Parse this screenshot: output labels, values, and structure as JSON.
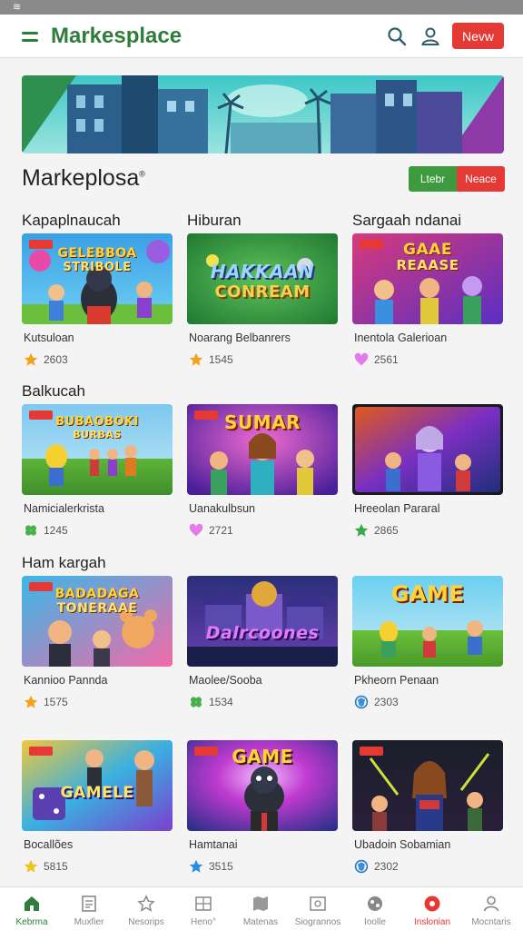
{
  "status_bar": {
    "glyph": "≋"
  },
  "header": {
    "title": "Markesplace",
    "new_button": "Nevw",
    "icons": [
      "menu-icon",
      "search-icon",
      "user-icon"
    ],
    "accent": "#2f7d3a",
    "button_color": "#e53935"
  },
  "section": {
    "title": "Markeplosa",
    "title_mark": "®",
    "toggle_left": "Ltebr",
    "toggle_right": "Neace"
  },
  "categories": {
    "c1": "Kapaplnaucah",
    "c2": "Hiburan",
    "c3": "Sargaah ndanai",
    "c4": "Balkucah",
    "c5": "Ham kargah"
  },
  "cards": [
    {
      "name": "Kutsuloan",
      "rating": "2603",
      "rating_icon": "star-icon",
      "thumb_title_1": "GELEBBOA",
      "thumb_title_2": "STRIBOLE"
    },
    {
      "name": "Noarang Belbanrers",
      "rating": "1545",
      "rating_icon": "star-icon",
      "thumb_title_1": "HAKKAAN",
      "thumb_title_2": "CONREAM"
    },
    {
      "name": "Inentola Galerioan",
      "rating": "2561",
      "rating_icon": "heart-icon",
      "thumb_title_1": "GAAE",
      "thumb_title_2": "REAASE"
    },
    {
      "name": "Namicialerkrista",
      "rating": "1245",
      "rating_icon": "clover-icon",
      "thumb_title_1": "BUBAOBOKI",
      "thumb_title_2": "BURBAS"
    },
    {
      "name": "Uanakulbsun",
      "rating": "2721",
      "rating_icon": "heart-icon",
      "thumb_title_1": "SUMAR",
      "thumb_title_2": ""
    },
    {
      "name": "Hreeolan Pararal",
      "rating": "2865",
      "rating_icon": "leaf-star-icon",
      "thumb_title_1": "",
      "thumb_title_2": ""
    },
    {
      "name": "Kannioo Pannda",
      "rating": "1575",
      "rating_icon": "star-icon",
      "thumb_title_1": "BADADAGA",
      "thumb_title_2": "TONERAAE"
    },
    {
      "name": "Maolee/Sooba",
      "rating": "1534",
      "rating_icon": "clover-icon",
      "thumb_title_1": "Dalrcoones",
      "thumb_title_2": ""
    },
    {
      "name": "Pkheorn Penaan",
      "rating": "2303",
      "rating_icon": "shield-icon",
      "thumb_title_1": "GAME",
      "thumb_title_2": ""
    },
    {
      "name": "Bocallões",
      "rating": "5815",
      "rating_icon": "star-icon",
      "thumb_title_1": "GAMELE",
      "thumb_title_2": ""
    },
    {
      "name": "Hamtanai",
      "rating": "3515",
      "rating_icon": "blue-star-icon",
      "thumb_title_1": "GAME",
      "thumb_title_2": ""
    },
    {
      "name": "Ubadoin Sobamian",
      "rating": "2302",
      "rating_icon": "shield-icon",
      "thumb_title_1": "",
      "thumb_title_2": ""
    }
  ],
  "bottom_nav": [
    {
      "label": "Kebrma",
      "icon": "home-icon",
      "state": "active"
    },
    {
      "label": "Muxfier",
      "icon": "document-icon",
      "state": ""
    },
    {
      "label": "Nesorips",
      "icon": "star-outline-icon",
      "state": ""
    },
    {
      "label": "Heno°",
      "icon": "grid-icon",
      "state": ""
    },
    {
      "label": "Matenas",
      "icon": "map-icon",
      "state": ""
    },
    {
      "label": "Siogrannos",
      "icon": "image-icon",
      "state": ""
    },
    {
      "label": "Ioolle",
      "icon": "globe-icon",
      "state": ""
    },
    {
      "label": "Inslonian",
      "icon": "record-icon",
      "state": "red"
    },
    {
      "label": "Mocntaris",
      "icon": "profile-icon",
      "state": ""
    }
  ]
}
